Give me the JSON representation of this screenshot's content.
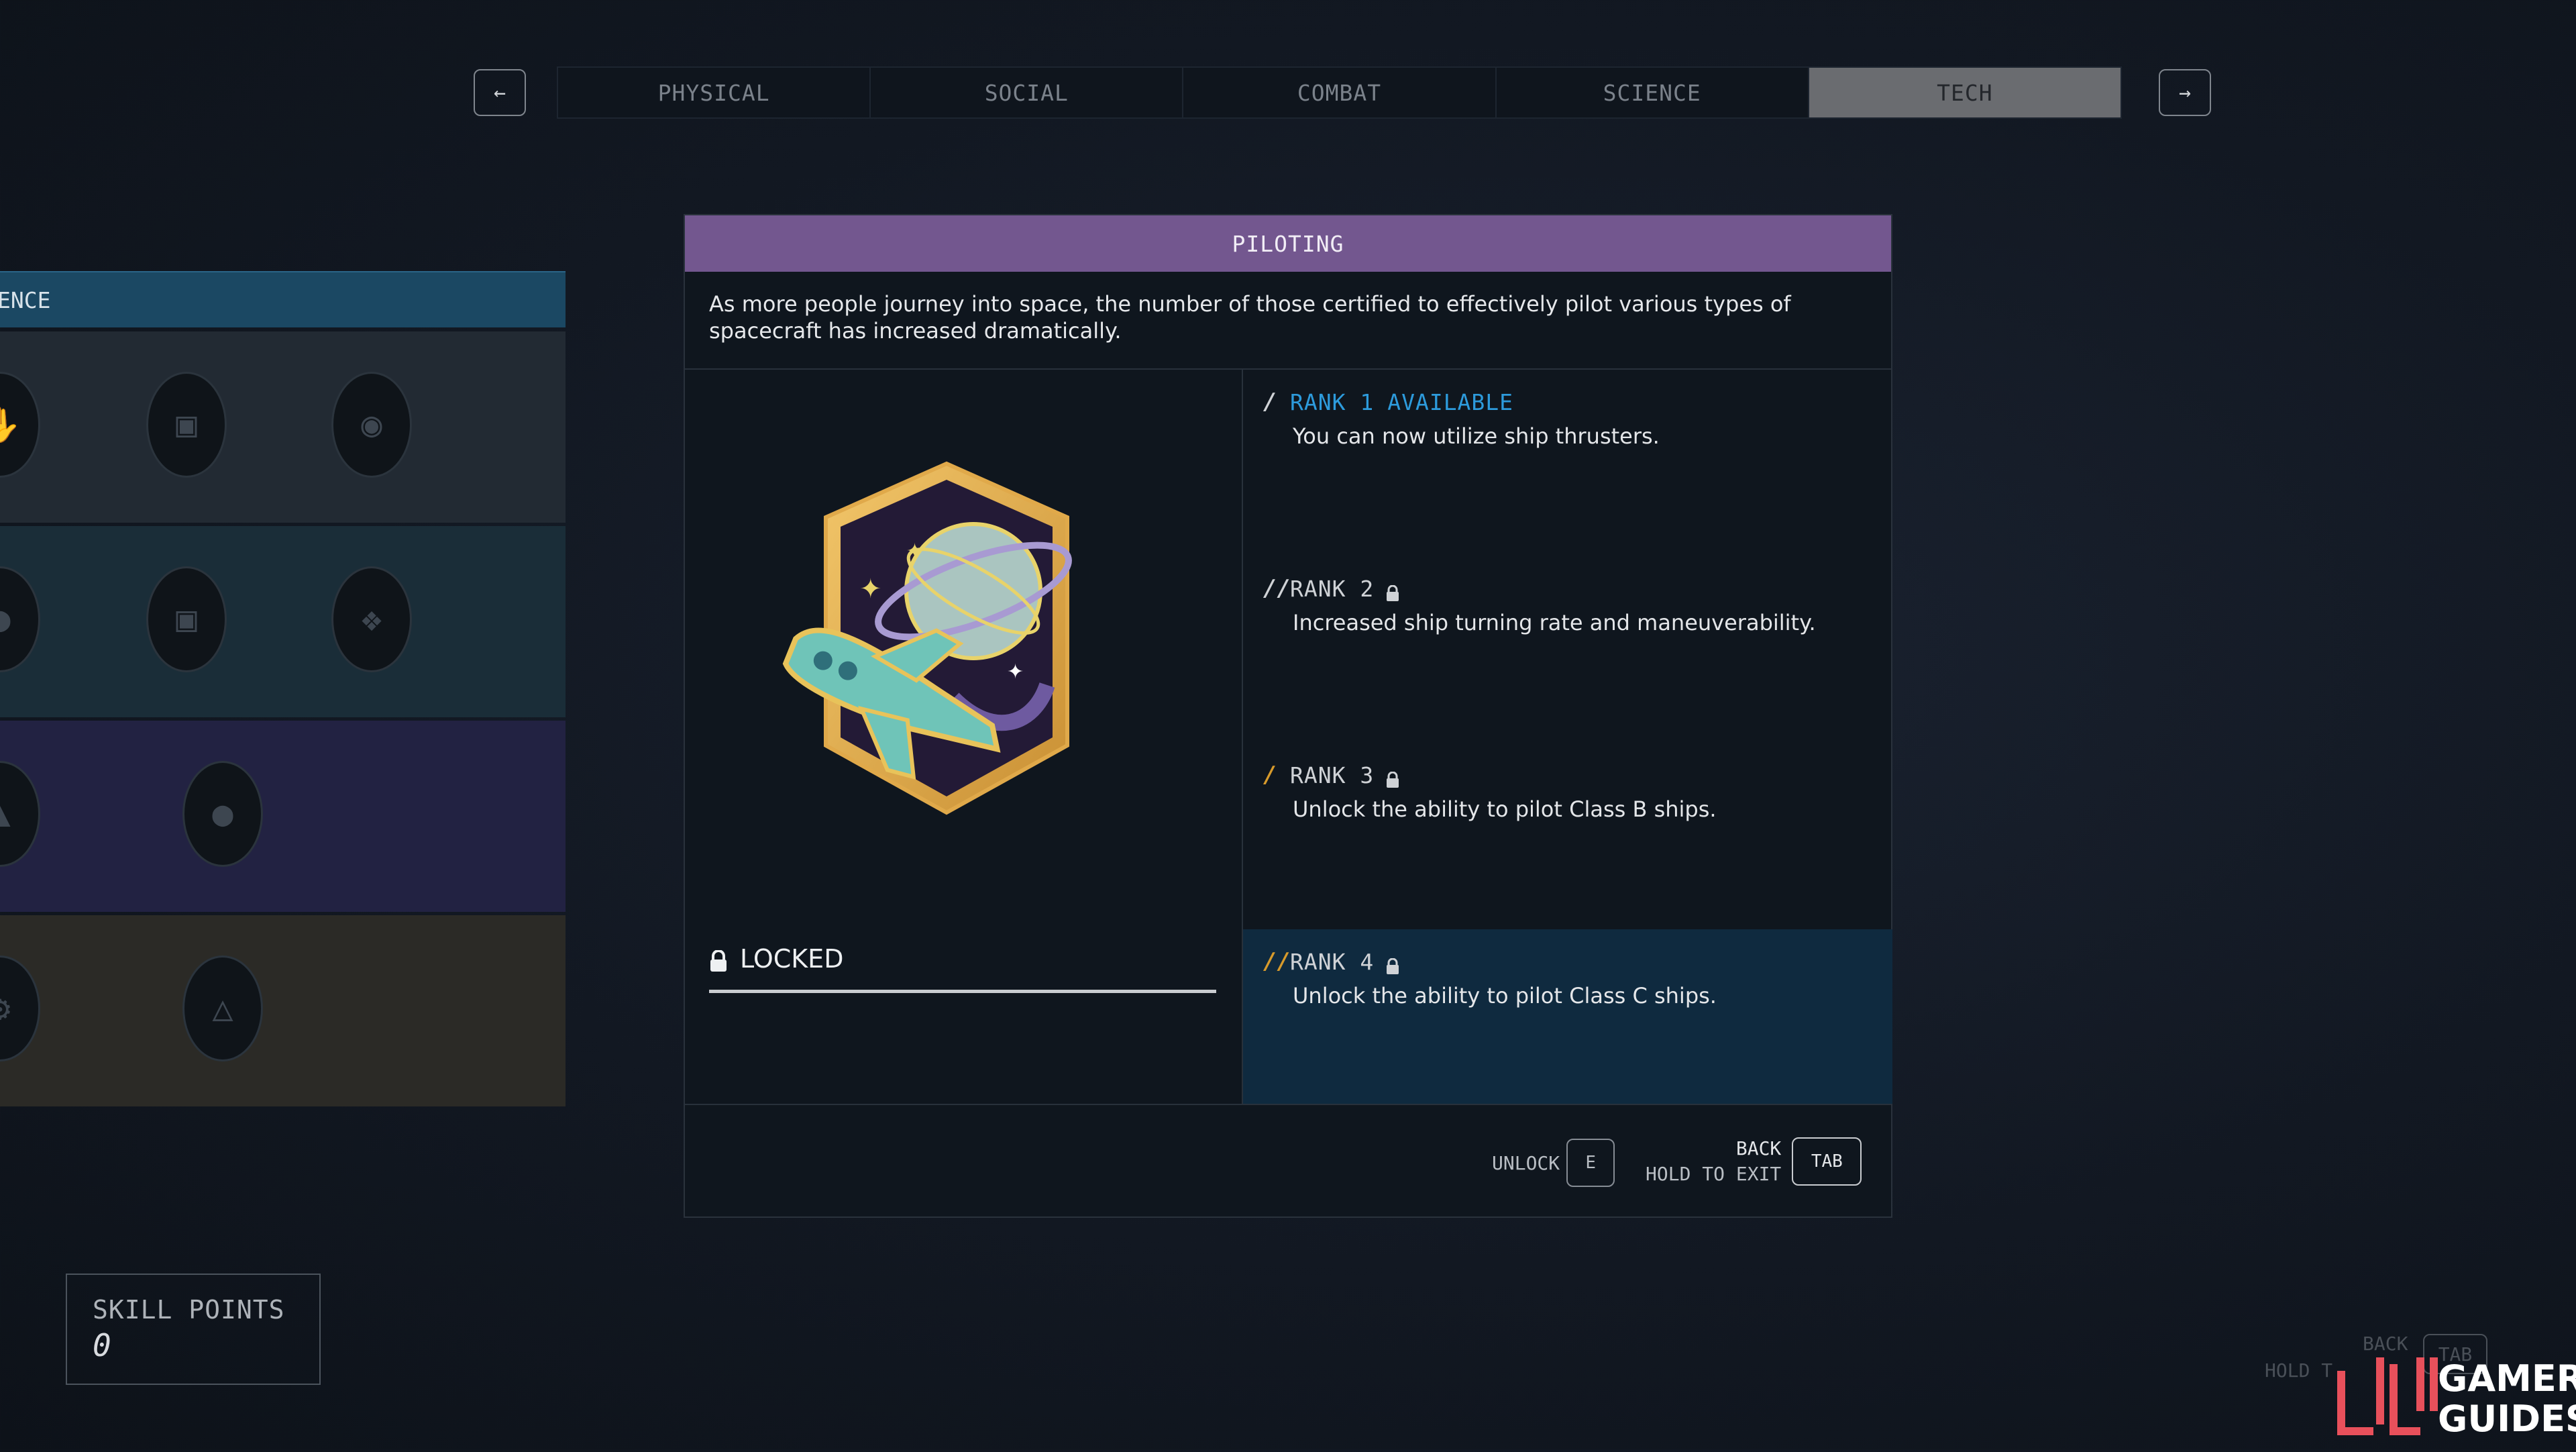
{
  "tabs": {
    "prev_icon": "arrow-left-icon",
    "next_icon": "arrow-right-icon",
    "items": [
      {
        "label": "PHYSICAL",
        "active": false
      },
      {
        "label": "SOCIAL",
        "active": false
      },
      {
        "label": "COMBAT",
        "active": false
      },
      {
        "label": "SCIENCE",
        "active": false
      },
      {
        "label": "TECH",
        "active": true
      }
    ]
  },
  "tree": {
    "header_label": "ENCE",
    "header_color": "#1b4863"
  },
  "skill": {
    "title": "PILOTING",
    "title_color": "#73578f",
    "description": "As more people journey into space, the number of those certified to effectively pilot various types of spacecraft has increased dramatically.",
    "status": "LOCKED",
    "ranks": [
      {
        "label": "RANK 1",
        "status": "AVAILABLE",
        "description": "You can now utilize ship thrusters.",
        "locked": false,
        "color": "#2d9bdc"
      },
      {
        "label": "RANK 2",
        "status": "",
        "description": "Increased ship turning rate and maneuverability.",
        "locked": true,
        "color": "#cfd2d6"
      },
      {
        "label": "RANK 3",
        "status": "",
        "description": "Unlock the ability to pilot Class B ships.",
        "locked": true,
        "color": "#d79a2b"
      },
      {
        "label": "RANK 4",
        "status": "",
        "description": "Unlock the ability to pilot Class C ships.",
        "locked": true,
        "color": "#d79a2b"
      }
    ]
  },
  "prompts": {
    "unlock_label": "UNLOCK",
    "unlock_key": "E",
    "back_label": "BACK",
    "hold_exit_label": "HOLD TO EXIT",
    "back_key": "TAB"
  },
  "skill_points": {
    "label": "SKILL POINTS",
    "value": "0"
  },
  "ghost_prompt": {
    "back": "BACK",
    "hold": "HOLD T",
    "key": "TAB"
  },
  "watermark": {
    "line1": "GAMER",
    "line2": "GUIDES"
  }
}
